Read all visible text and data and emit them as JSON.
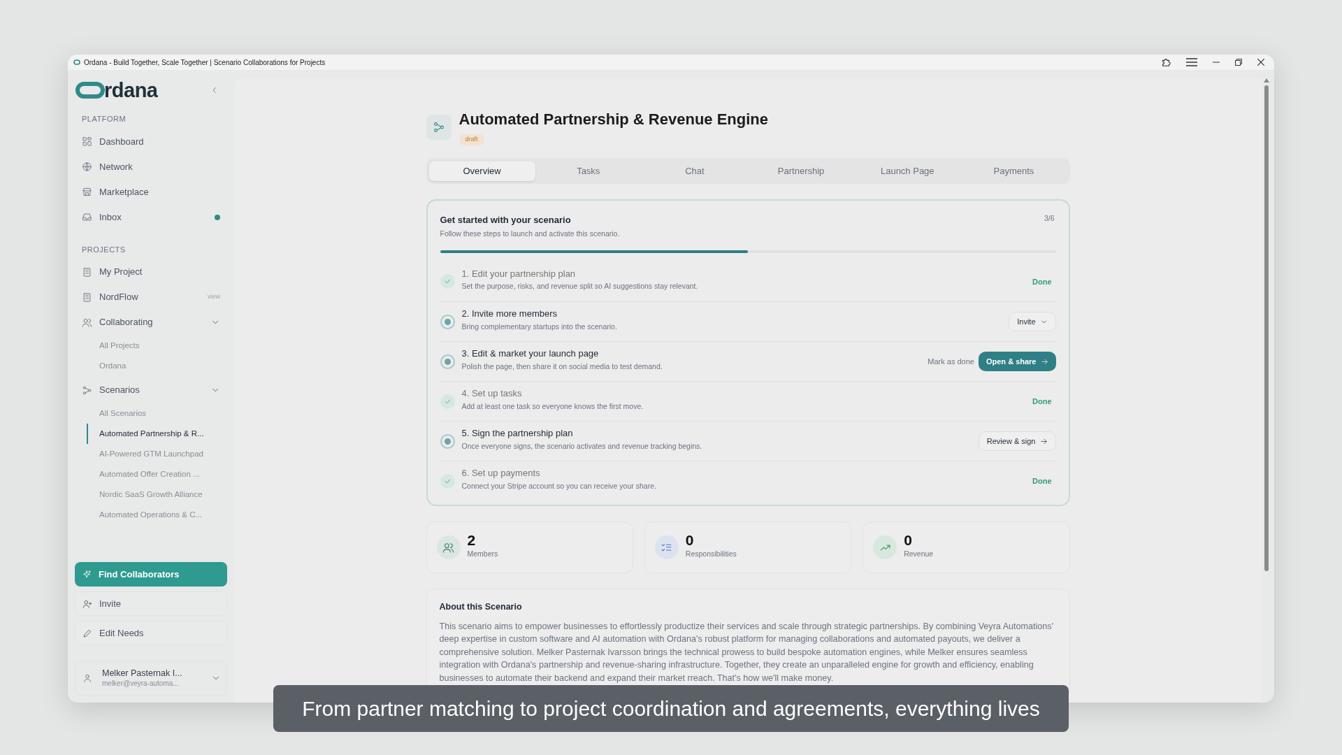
{
  "window": {
    "title": "Ordana - Build Together, Scale Together | Scenario Collaborations for Projects"
  },
  "sidebar": {
    "logo_text": "rdana",
    "sections": [
      {
        "heading": "PLATFORM",
        "items": [
          {
            "label": "Dashboard",
            "unread": false
          },
          {
            "label": "Network",
            "unread": false
          },
          {
            "label": "Marketplace",
            "unread": false
          },
          {
            "label": "Inbox",
            "unread": true
          }
        ]
      },
      {
        "heading": "PROJECTS",
        "items": [
          {
            "label": "My Project"
          },
          {
            "label": "NordFlow",
            "hint": "view"
          },
          {
            "label": "Collaborating",
            "expanded": true,
            "children": [
              {
                "label": "All Projects",
                "selected": false
              },
              {
                "label": "Ordana",
                "selected": false
              }
            ]
          },
          {
            "label": "Scenarios",
            "expanded": true,
            "children": [
              {
                "label": "All Scenarios",
                "selected": false
              },
              {
                "label": "Automated Partnership & R...",
                "selected": true
              },
              {
                "label": "AI-Powered GTM Launchpad",
                "selected": false
              },
              {
                "label": "Automated Offer Creation ...",
                "selected": false
              },
              {
                "label": "Nordic SaaS Growth Alliance",
                "selected": false
              },
              {
                "label": "Automated Operations & C...",
                "selected": false
              }
            ]
          }
        ]
      }
    ],
    "actions": [
      {
        "label": "Find Collaborators",
        "kind": "primary"
      },
      {
        "label": "Invite",
        "kind": "secondary"
      },
      {
        "label": "Edit Needs",
        "kind": "secondary"
      }
    ],
    "user": {
      "name": "Melker Pasternak I...",
      "email": "melker@veyra-automa..."
    }
  },
  "header": {
    "title": "Automated Partnership & Revenue Engine",
    "status": "draft"
  },
  "tabs": [
    {
      "label": "Overview",
      "selected": true
    },
    {
      "label": "Tasks",
      "selected": false
    },
    {
      "label": "Chat",
      "selected": false
    },
    {
      "label": "Partnership",
      "selected": false
    },
    {
      "label": "Launch Page",
      "selected": false
    },
    {
      "label": "Payments",
      "selected": false
    }
  ],
  "checklist": {
    "title": "Get started with your scenario",
    "subtitle": "Follow these steps to launch and activate this scenario.",
    "count": "3/6",
    "level": 0.5,
    "steps": [
      {
        "title": "1. Edit your partnership plan",
        "description": "Set the purpose, risks, and revenue split so AI suggestions stay relevant.",
        "done": true,
        "action": {
          "kind": "status",
          "label": "Done"
        }
      },
      {
        "title": "2. Invite more members",
        "description": "Bring complementary startups into the scenario.",
        "done": false,
        "action": {
          "kind": "dropdown",
          "label": "Invite"
        }
      },
      {
        "title": "3. Edit & market your launch page",
        "description": "Polish the page, then share it on social media to test demand.",
        "done": false,
        "action": {
          "kind": "primary",
          "label": "Open & share",
          "link": "Mark as done"
        }
      },
      {
        "title": "4. Set up tasks",
        "description": "Add at least one task so everyone knows the first move.",
        "done": true,
        "action": {
          "kind": "status",
          "label": "Done"
        }
      },
      {
        "title": "5. Sign the partnership plan",
        "description": "Once everyone signs, the scenario activates and revenue tracking begins.",
        "done": false,
        "action": {
          "kind": "secondary",
          "label": "Review & sign"
        }
      },
      {
        "title": "6. Set up payments",
        "description": "Connect your Stripe account so you can receive your share.",
        "done": true,
        "action": {
          "kind": "status",
          "label": "Done"
        }
      }
    ]
  },
  "stats": [
    {
      "value": "2",
      "label": "Members"
    },
    {
      "value": "0",
      "label": "Responsibilities"
    },
    {
      "value": "0",
      "label": "Revenue"
    }
  ],
  "about": {
    "title": "About this Scenario",
    "text": "This scenario aims to empower businesses to effortlessly productize their services and scale through strategic partnerships. By combining Veyra Automations' deep expertise in custom software and AI automation with Ordana's robust platform for managing collaborations and automated payouts, we deliver a comprehensive solution. Melker Pasternak Ivarsson brings the technical prowess to build bespoke automation engines, while Melker ensures seamless integration with Ordana's partnership and revenue-sharing infrastructure. Together, they create an unparalleled engine for growth and efficiency, enabling businesses to automate their backend and expand their market rreach. That's how we'll make money."
  },
  "caption": "From partner matching to project coordination and agreements, everything lives"
}
